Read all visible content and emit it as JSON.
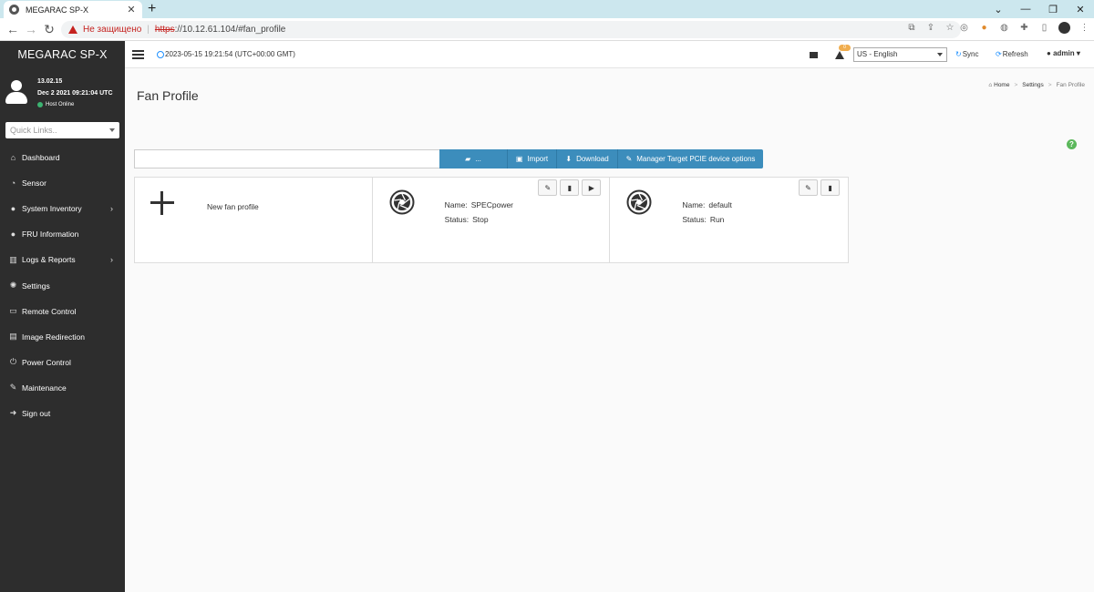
{
  "browser": {
    "tab_title": "MEGARAC SP-X",
    "tab_close": "✕",
    "new_tab": "+",
    "insecure_label": "Не защищено",
    "url_scheme": "https",
    "url_rest": "://10.12.61.104/#fan_profile",
    "window_controls": [
      "⌄",
      "—",
      "❐",
      "✕"
    ]
  },
  "sidebar": {
    "brand": "MEGARAC SP-X",
    "fw_version": "13.02.15",
    "fw_date": "Dec 2 2021 09:21:04 UTC",
    "host_status": "Host Online",
    "quicklinks_placeholder": "Quick Links..",
    "items": [
      {
        "label": "Dashboard",
        "icon": "home-icon",
        "glyph": "⌂"
      },
      {
        "label": "Sensor",
        "icon": "dashboard-gauge-icon",
        "glyph": "◔"
      },
      {
        "label": "System Inventory",
        "icon": "info-circle-icon",
        "glyph": "●"
      },
      {
        "label": "FRU Information",
        "icon": "info-circle-icon",
        "glyph": "●"
      },
      {
        "label": "Logs & Reports",
        "icon": "bar-chart-icon",
        "glyph": "▥"
      },
      {
        "label": "Settings",
        "icon": "gear-icon",
        "glyph": "✺"
      },
      {
        "label": "Remote Control",
        "icon": "monitor-icon",
        "glyph": "▭"
      },
      {
        "label": "Image Redirection",
        "icon": "disk-icon",
        "glyph": "▤"
      },
      {
        "label": "Power Control",
        "icon": "power-icon",
        "glyph": "⏻"
      },
      {
        "label": "Maintenance",
        "icon": "wrench-icon",
        "glyph": "✎"
      },
      {
        "label": "Sign out",
        "icon": "sign-out-icon",
        "glyph": "➜"
      }
    ]
  },
  "header": {
    "datetime": "2023-05-15 19:21:54 (UTC+00:00 GMT)",
    "alert_count": "0",
    "language": "US - English",
    "sync_label": "Sync",
    "refresh_label": "Refresh",
    "user_label": "admin"
  },
  "page": {
    "title": "Fan Profile",
    "breadcrumb": [
      "Home",
      "Settings",
      "Fan Profile"
    ],
    "help_glyph": "?"
  },
  "toolbar": {
    "folder_label": "...",
    "import_label": "Import",
    "download_label": "Download",
    "pcie_label": "Manager Target PCIE device options"
  },
  "cards": {
    "new_label": "New fan profile",
    "name_key": "Name:",
    "status_key": "Status:",
    "profiles": [
      {
        "name": "SPECpower",
        "status": "Stop"
      },
      {
        "name": "default",
        "status": "Run"
      }
    ]
  },
  "colors": {
    "sidebar_bg": "#2d2d2d",
    "button_blue": "#3c8dbc",
    "status_online": "#3cb371",
    "badge": "#f0ad4e",
    "help_green": "#5cb85c"
  }
}
